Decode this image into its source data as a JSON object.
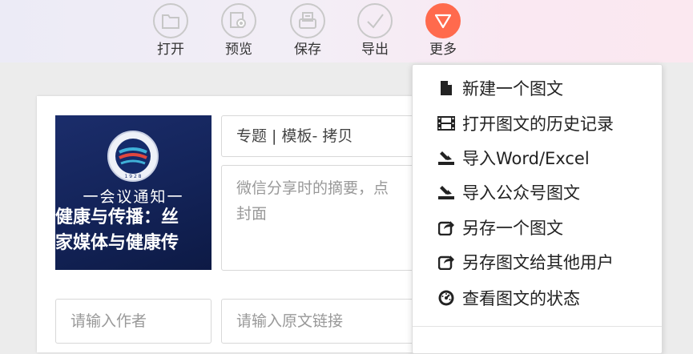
{
  "toolbar": {
    "items": [
      {
        "label": "打开",
        "icon": "folder-icon"
      },
      {
        "label": "预览",
        "icon": "preview-icon"
      },
      {
        "label": "保存",
        "icon": "save-icon"
      },
      {
        "label": "导出",
        "icon": "check-icon"
      },
      {
        "label": "更多",
        "icon": "triangle-down-icon"
      }
    ],
    "accent": "#ff6a4d"
  },
  "editor": {
    "cover": {
      "notice": "一会议通知一",
      "line1": "健康与传播：丝",
      "line2": "家媒体与健康传",
      "emblem_year": "1 9 2 8"
    },
    "title_value": "专题 | 模板- 拷贝",
    "summary_placeholder": "微信分享时的摘要，点\n封面",
    "author_placeholder": "请输入作者",
    "link_placeholder": "请输入原文链接"
  },
  "more_menu": {
    "items": [
      {
        "label": "新建一个图文",
        "icon": "file-icon"
      },
      {
        "label": "打开图文的历史记录",
        "icon": "film-icon"
      },
      {
        "label": "导入Word/Excel",
        "icon": "import-icon"
      },
      {
        "label": "导入公众号图文",
        "icon": "import-icon"
      },
      {
        "label": "另存一个图文",
        "icon": "share-icon"
      },
      {
        "label": "另存图文给其他用户",
        "icon": "share-icon"
      },
      {
        "label": "查看图文的状态",
        "icon": "dashboard-icon"
      }
    ]
  }
}
